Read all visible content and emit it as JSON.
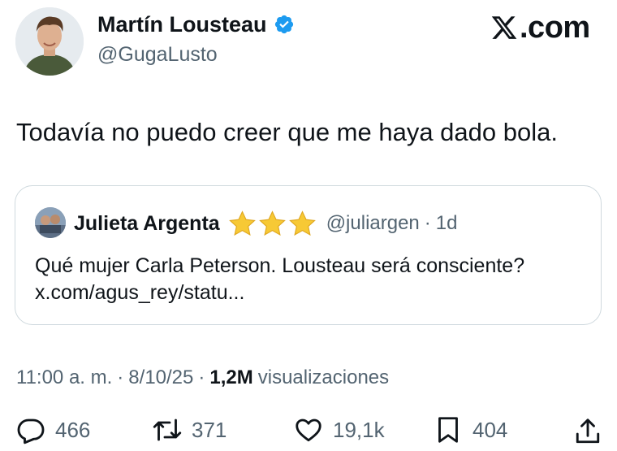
{
  "brand": {
    "site_label": ".com"
  },
  "author": {
    "name": "Martín Lousteau",
    "handle": "@GugaLusto",
    "verified": true
  },
  "tweet": {
    "text": "Todavía no puedo creer que me haya dado bola."
  },
  "quoted_post": {
    "name": "Julieta Argenta",
    "handle": "@juliargen",
    "separator": "·",
    "time": "1d",
    "text": "Qué mujer Carla Peterson. Lousteau será consciente? x.com/agus_rey/statu..."
  },
  "meta": {
    "time": "11:00 a. m.",
    "sep1": "·",
    "date": "8/10/25",
    "sep2": "·",
    "views_count": "1,2M",
    "views_label": "visualizaciones"
  },
  "actions": {
    "replies": "466",
    "reposts": "371",
    "likes": "19,1k",
    "bookmarks": "404"
  },
  "colors": {
    "verified": "#1d9bf0",
    "secondary_text": "#536471",
    "border": "#cfd9de",
    "star": "#f4c430"
  }
}
